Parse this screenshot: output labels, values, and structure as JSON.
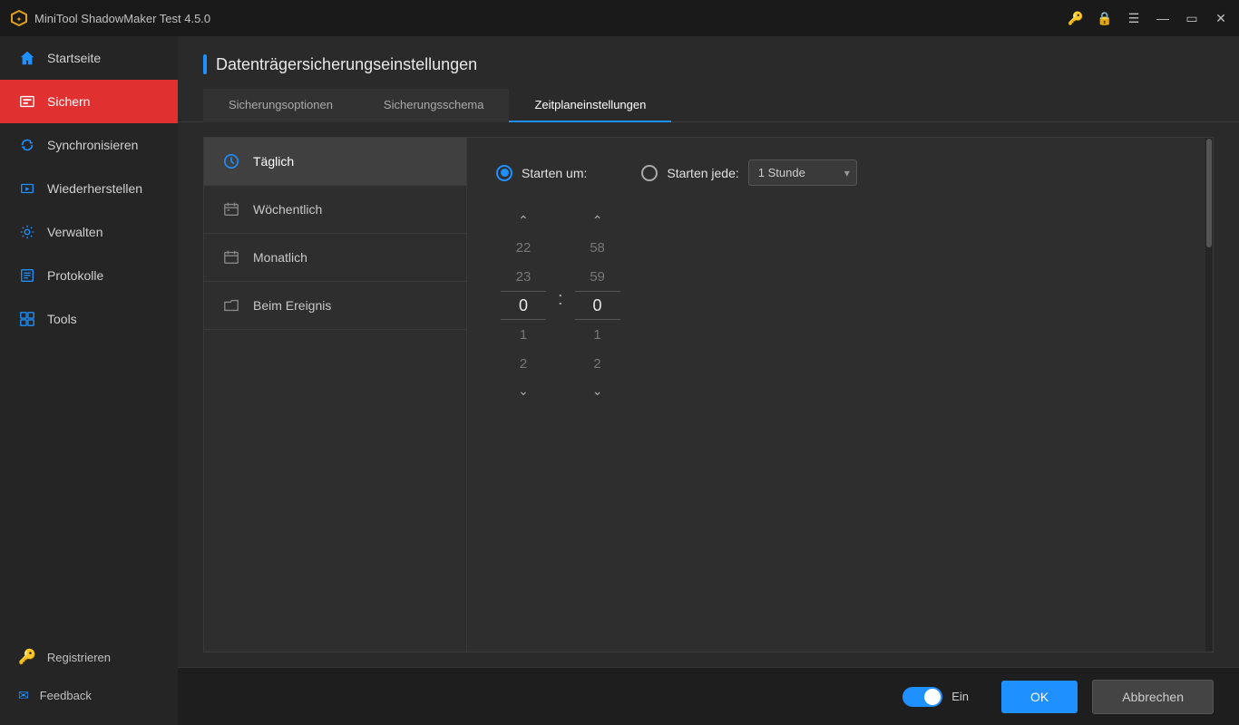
{
  "titlebar": {
    "title": "MiniTool ShadowMaker Test 4.5.0",
    "logo": "shield"
  },
  "sidebar": {
    "items": [
      {
        "id": "startseite",
        "label": "Startseite",
        "icon": "home",
        "active": false
      },
      {
        "id": "sichern",
        "label": "Sichern",
        "icon": "backup",
        "active": true
      },
      {
        "id": "synchronisieren",
        "label": "Synchronisieren",
        "icon": "sync",
        "active": false
      },
      {
        "id": "wiederherstellen",
        "label": "Wiederherstellen",
        "icon": "restore",
        "active": false
      },
      {
        "id": "verwalten",
        "label": "Verwalten",
        "icon": "manage",
        "active": false
      },
      {
        "id": "protokolle",
        "label": "Protokolle",
        "icon": "log",
        "active": false
      },
      {
        "id": "tools",
        "label": "Tools",
        "icon": "tools",
        "active": false
      }
    ],
    "bottom": [
      {
        "id": "registrieren",
        "label": "Registrieren",
        "icon": "key"
      },
      {
        "id": "feedback",
        "label": "Feedback",
        "icon": "mail"
      }
    ]
  },
  "page": {
    "title": "Datenträgersicherungseinstellungen"
  },
  "tabs": [
    {
      "id": "sicherungsoptionen",
      "label": "Sicherungsoptionen",
      "active": false
    },
    {
      "id": "sicherungsschema",
      "label": "Sicherungsschema",
      "active": false
    },
    {
      "id": "zeitplaneinstellungen",
      "label": "Zeitplaneinstellungen",
      "active": true
    }
  ],
  "schedule": {
    "types": [
      {
        "id": "taeglich",
        "label": "Täglich",
        "icon": "clock",
        "active": true
      },
      {
        "id": "woechentlich",
        "label": "Wöchentlich",
        "icon": "calendar-week",
        "active": false
      },
      {
        "id": "monatlich",
        "label": "Monatlich",
        "icon": "calendar-month",
        "active": false
      },
      {
        "id": "beim-ereignis",
        "label": "Beim Ereignis",
        "icon": "folder-event",
        "active": false
      }
    ],
    "radio": {
      "starten_um": "Starten um:",
      "starten_jede": "Starten jede:"
    },
    "interval_option": "1 Stunde",
    "time": {
      "hour": "0",
      "minute": "0",
      "before_hour": [
        "22",
        "23"
      ],
      "after_hour": [
        "1",
        "2"
      ],
      "before_minute": [
        "58",
        "59"
      ],
      "after_minute": [
        "1",
        "2"
      ]
    }
  },
  "footer": {
    "toggle_label": "Ein",
    "ok_label": "OK",
    "abbrechen_label": "Abbrechen"
  }
}
